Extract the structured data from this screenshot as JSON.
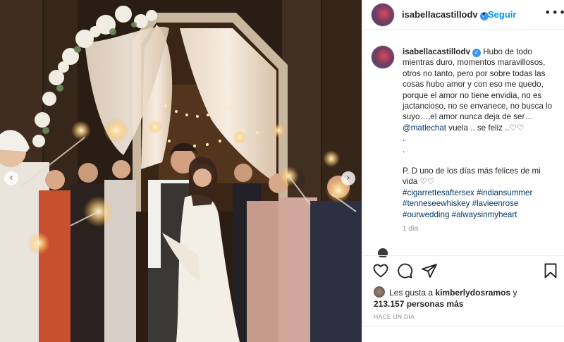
{
  "post": {
    "username": "isabellacastillodv",
    "verified_glyph": "✓",
    "follow_separator": "•",
    "follow_label": "Seguir",
    "more_label": "•••",
    "prev_arrow": "‹",
    "next_arrow": "›"
  },
  "caption": {
    "username": "isabellacastillodv",
    "line1_rest": "Hubo de todo",
    "lines": [
      "mientras duro, momentos maravillosos,",
      "otros no tanto, pero por sobre todas las",
      "cosas hubo amor y con eso me quedo,",
      "porque el amor no tiene envidia, no es",
      "jactancioso, no se envanece, no busca lo",
      "suyo…,el amor nunca deja de ser…"
    ],
    "mention": "@matlechat",
    "mention_rest": "vuela .. se feliz ..♡♡",
    "dot1": ".",
    "dot2": ".",
    "pd_line1": "P. D uno de los días más felices de mi",
    "pd_line2": "vida ♡♡",
    "hashtags_line1": [
      "#cigarrettesaftersex",
      "#indiansummer"
    ],
    "hashtags_line2": [
      "#tenneseewhiskey",
      "#lavieenrose"
    ],
    "hashtags_line3": [
      "#ourwedding",
      "#alwaysinmyheart"
    ],
    "time": "1 día"
  },
  "likes": {
    "prefix": "Les gusta a",
    "user": "kimberlydosramos",
    "joiner": "y",
    "count": "213.157 personas más"
  },
  "posted_ago": "HACE UN DÍA",
  "icons": {
    "heart": "heart-icon",
    "comment": "comment-icon",
    "share": "share-icon",
    "save": "bookmark-icon"
  },
  "colors": {
    "link": "#00376b",
    "follow": "#0095f6",
    "verified": "#3897f0",
    "muted": "#8e8e8e"
  }
}
